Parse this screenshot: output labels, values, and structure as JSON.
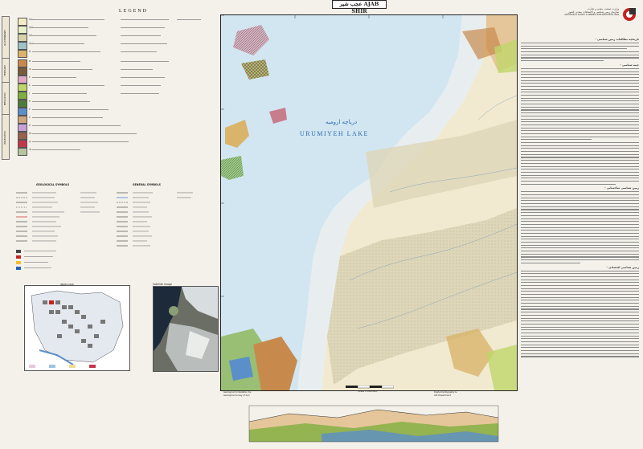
{
  "header": {
    "sheet_title": "AJAB SHIR",
    "sheet_title_fa": "عجب شیر",
    "legend_title": "LEGEND"
  },
  "organization": {
    "name_lines": [
      "وزارت صنعت، معدن و تجارت",
      "سازمان زمین شناسی و اکتشافات معدنی کشور",
      "GEOLOGICAL SURVEY & MINERAL EXPLORATION OF IRAN"
    ]
  },
  "legend": {
    "eras": [
      "QUATERNARY",
      "TERTIARY",
      "MESOZOIC",
      "PALEOZOIC"
    ],
    "units": [
      {
        "color": "#f3ecc4",
        "label": "Qal"
      },
      {
        "color": "#e7f0c8",
        "label": "Qt2"
      },
      {
        "color": "#d7d2a8",
        "label": "Qt1"
      },
      {
        "color": "#9fc3c6",
        "label": "Qsw"
      },
      {
        "color": "#d9b46a",
        "label": "Pl"
      },
      {
        "color": "#c88a4c",
        "label": "M"
      },
      {
        "color": "#7a5a3a",
        "label": "Ol"
      },
      {
        "color": "#e1a9c5",
        "label": "E"
      },
      {
        "color": "#bfd66a",
        "label": "K"
      },
      {
        "color": "#7fae3e",
        "label": "J"
      },
      {
        "color": "#4f7c3a",
        "label": "Tr"
      },
      {
        "color": "#5b8fc9",
        "label": "P"
      },
      {
        "color": "#cfa77c",
        "label": "C"
      },
      {
        "color": "#c8a0d8",
        "label": "D"
      },
      {
        "color": "#96634d",
        "label": "PC"
      },
      {
        "color": "#c2374a",
        "label": "gr"
      },
      {
        "color": "#b6c4a0",
        "label": "db"
      }
    ],
    "symbol_titles": [
      "GEOLOGICAL SYMBOLS",
      "GENERAL SYMBOLS"
    ]
  },
  "index": {
    "index_label": "INDEX MAP",
    "satellite_label": "Satellite image"
  },
  "map": {
    "lake_name_fa": "دریاچه ارومیه",
    "lake_name_en": "URUMIYEH LAKE",
    "scale": "Scale 1:100,000",
    "credits_left": [
      "Geological Compilation by:",
      "Geological Survey of Iran"
    ],
    "credits_right": [
      "Digital Cartography &",
      "GIS Department"
    ]
  },
  "right_panel": {
    "headings": [
      "- تاریخچه مطالعات زمین شناسی",
      "- چینه شناسی",
      "- زمین شناسی ساختمانی",
      "- زمین شناسی اقتصادی"
    ]
  },
  "colors": {
    "lake": "#d2e6f1",
    "shore": "#e8eef0",
    "alluvium": "#f1ead0",
    "terrace": "#ddd6b8"
  }
}
